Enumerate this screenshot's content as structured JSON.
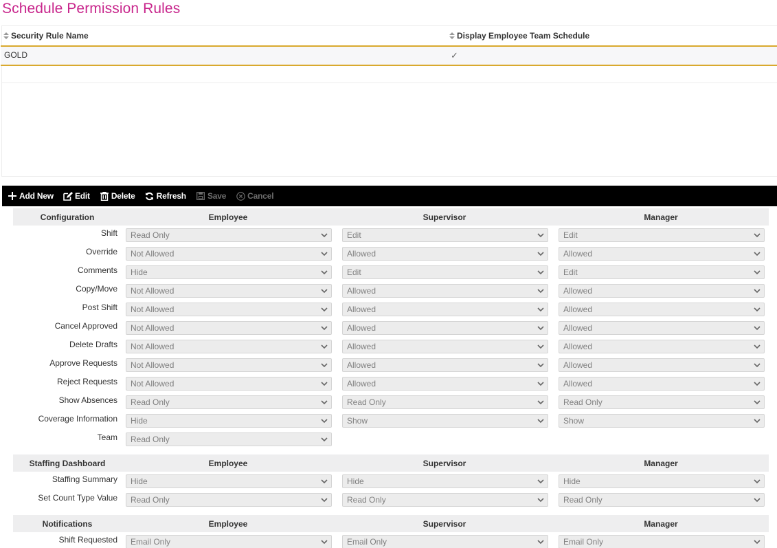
{
  "page": {
    "title": "Schedule Permission Rules"
  },
  "colors": {
    "title": "#c8268c",
    "selected_row_border": "#d9a92e",
    "toolbar_bg": "#000000"
  },
  "grid": {
    "columns": [
      {
        "label": "Security Rule Name",
        "icon": "sort-icon"
      },
      {
        "label": "Display Employee Team Schedule",
        "icon": "sort-icon"
      }
    ],
    "rows": [
      {
        "security_rule_name": "GOLD",
        "display_employee_team_schedule": "✓"
      }
    ]
  },
  "toolbar": {
    "buttons": [
      {
        "label": "Add New",
        "icon": "plus-icon",
        "enabled": true
      },
      {
        "label": "Edit",
        "icon": "edit-icon",
        "enabled": true
      },
      {
        "label": "Delete",
        "icon": "trash-icon",
        "enabled": true
      },
      {
        "label": "Refresh",
        "icon": "refresh-icon",
        "enabled": true
      },
      {
        "label": "Save",
        "icon": "save-icon",
        "enabled": false
      },
      {
        "label": "Cancel",
        "icon": "cancel-icon",
        "enabled": false
      }
    ]
  },
  "form": {
    "sections": [
      {
        "title": "Configuration",
        "columns": [
          "Employee",
          "Supervisor",
          "Manager"
        ],
        "rows": [
          {
            "label": "Shift",
            "employee": "Read Only",
            "supervisor": "Edit",
            "manager": "Edit"
          },
          {
            "label": "Override",
            "employee": "Not Allowed",
            "supervisor": "Allowed",
            "manager": "Allowed"
          },
          {
            "label": "Comments",
            "employee": "Hide",
            "supervisor": "Edit",
            "manager": "Edit"
          },
          {
            "label": "Copy/Move",
            "employee": "Not Allowed",
            "supervisor": "Allowed",
            "manager": "Allowed"
          },
          {
            "label": "Post Shift",
            "employee": "Not Allowed",
            "supervisor": "Allowed",
            "manager": "Allowed"
          },
          {
            "label": "Cancel Approved",
            "employee": "Not Allowed",
            "supervisor": "Allowed",
            "manager": "Allowed"
          },
          {
            "label": "Delete Drafts",
            "employee": "Not Allowed",
            "supervisor": "Allowed",
            "manager": "Allowed"
          },
          {
            "label": "Approve Requests",
            "employee": "Not Allowed",
            "supervisor": "Allowed",
            "manager": "Allowed"
          },
          {
            "label": "Reject Requests",
            "employee": "Not Allowed",
            "supervisor": "Allowed",
            "manager": "Allowed"
          },
          {
            "label": "Show Absences",
            "employee": "Read Only",
            "supervisor": "Read Only",
            "manager": "Read Only"
          },
          {
            "label": "Coverage Information",
            "employee": "Hide",
            "supervisor": "Show",
            "manager": "Show"
          },
          {
            "label": "Team",
            "employee": "Read Only"
          }
        ]
      },
      {
        "title": "Staffing Dashboard",
        "columns": [
          "Employee",
          "Supervisor",
          "Manager"
        ],
        "rows": [
          {
            "label": "Staffing Summary",
            "employee": "Hide",
            "supervisor": "Hide",
            "manager": "Hide"
          },
          {
            "label": "Set Count Type Value",
            "employee": "Read Only",
            "supervisor": "Read Only",
            "manager": "Read Only"
          }
        ]
      },
      {
        "title": "Notifications",
        "columns": [
          "Employee",
          "Supervisor",
          "Manager"
        ],
        "rows": [
          {
            "label": "Shift Requested",
            "employee": "Email Only",
            "supervisor": "Email Only",
            "manager": "Email Only"
          }
        ]
      }
    ]
  }
}
